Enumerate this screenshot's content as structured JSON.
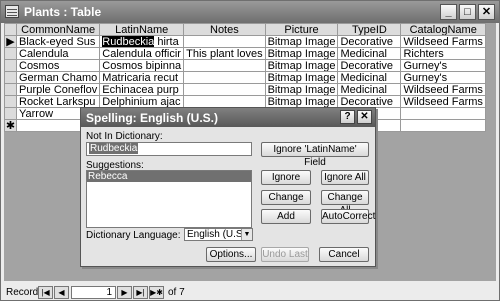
{
  "window": {
    "title": "Plants : Table",
    "min": "_",
    "max": "□",
    "close": "✕"
  },
  "table": {
    "headers": [
      "CommonName",
      "LatinName",
      "Notes",
      "Picture",
      "TypeID",
      "CatalogName"
    ],
    "rows": [
      [
        "Black-eyed Sus",
        "Rudbeckia hirta",
        "",
        "Bitmap Image",
        "Decorative",
        "Wildseed Farms"
      ],
      [
        "Calendula",
        "Calendula officir",
        "This plant loves",
        "Bitmap Image",
        "Medicinal",
        "Richters"
      ],
      [
        "Cosmos",
        "Cosmos bipinna",
        "",
        "Bitmap Image",
        "Decorative",
        "Gurney's"
      ],
      [
        "German Chamo",
        "Matricaria recut",
        "",
        "Bitmap Image",
        "Medicinal",
        "Gurney's"
      ],
      [
        "Purple Coneflov",
        "Echinacea purp",
        "",
        "Bitmap Image",
        "Medicinal",
        "Wildseed Farms"
      ],
      [
        "Rocket Larkspu",
        "Delphinium ajac",
        "",
        "Bitmap Image",
        "Decorative",
        "Wildseed Farms"
      ],
      [
        "Yarrow",
        "",
        "",
        "",
        "",
        ""
      ]
    ],
    "highlight_word": "Rudbeckia",
    "highlight_rest": " hirta",
    "current_marker": "▶",
    "new_marker": "✱"
  },
  "navigation": {
    "label": "Record:",
    "current": "1",
    "of_text": "of 7"
  },
  "dialog": {
    "title": "Spelling: English (U.S.)",
    "help": "?",
    "close": "✕",
    "not_in_dict_label": "Not In Dictionary:",
    "not_in_dict_value": "Rudbeckia",
    "ignore_field_button": "Ignore 'LatinName' Field",
    "suggestions_label": "Suggestions:",
    "suggestions": [
      "Rebecca"
    ],
    "ignore_button": "Ignore",
    "ignore_all_button": "Ignore All",
    "change_button": "Change",
    "change_all_button": "Change All",
    "add_button": "Add",
    "autocorrect_button": "AutoCorrect",
    "language_label": "Dictionary Language:",
    "language_value": "English (U.S.)",
    "options_button": "Options...",
    "undo_button": "Undo Last",
    "cancel_button": "Cancel"
  }
}
